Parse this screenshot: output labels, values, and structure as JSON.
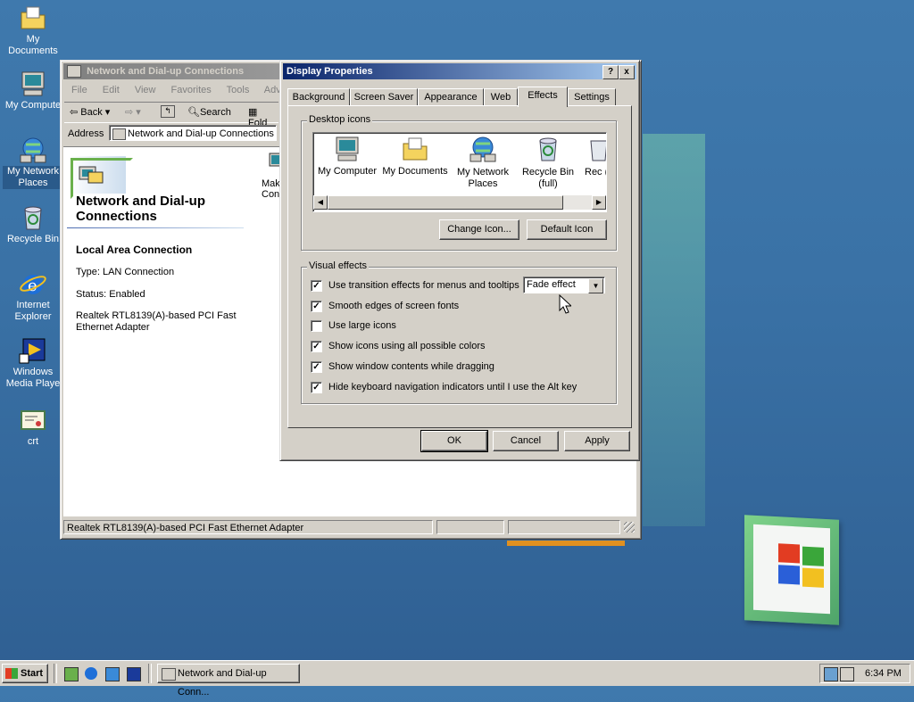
{
  "desktop": {
    "icons": [
      {
        "label": "My Documents",
        "icon": "folder-documents-icon"
      },
      {
        "label": "My Compute",
        "icon": "my-computer-icon"
      },
      {
        "label": "My Network Places",
        "icon": "network-places-icon"
      },
      {
        "label": "Recycle Bin",
        "icon": "recycle-bin-icon"
      },
      {
        "label": "Internet Explorer",
        "icon": "internet-explorer-icon"
      },
      {
        "label": "Windows Media Playe",
        "icon": "media-player-icon"
      },
      {
        "label": "crt",
        "icon": "certificate-icon"
      }
    ]
  },
  "explorer": {
    "title": "Network and Dial-up Connections",
    "menu": [
      "File",
      "Edit",
      "View",
      "Favorites",
      "Tools",
      "Adva"
    ],
    "toolbar": {
      "back": "Back",
      "search": "Search",
      "folders": "Fold"
    },
    "address_label": "Address",
    "address_value": "Network and Dial-up Connections",
    "heading": "Network and Dial-up Connections",
    "item_name": "Local Area Connection",
    "item_type": "Type: LAN Connection",
    "item_status": "Status: Enabled",
    "item_adapter": "Realtek RTL8139(A)-based PCI Fast Ethernet Adapter",
    "make_new": "Make Conne",
    "statusbar": "Realtek RTL8139(A)-based PCI Fast Ethernet Adapter"
  },
  "dialog": {
    "title": "Display Properties",
    "help_btn": "?",
    "close_btn": "x",
    "tabs": [
      "Background",
      "Screen Saver",
      "Appearance",
      "Web",
      "Effects",
      "Settings"
    ],
    "active_tab": "Effects",
    "desktop_icons_group": "Desktop icons",
    "icon_list": [
      {
        "label": "My Computer"
      },
      {
        "label": "My Documents"
      },
      {
        "label": "My Network Places"
      },
      {
        "label": "Recycle Bin (full)"
      },
      {
        "label": "Rec (e"
      }
    ],
    "change_icon": "Change Icon...",
    "default_icon": "Default Icon",
    "visual_effects_group": "Visual effects",
    "effects": [
      {
        "label": "Use transition effects for menus and tooltips",
        "checked": true
      },
      {
        "label": "Smooth edges of screen fonts",
        "checked": true
      },
      {
        "label": "Use large icons",
        "checked": false
      },
      {
        "label": "Show icons using all possible colors",
        "checked": true
      },
      {
        "label": "Show window contents while dragging",
        "checked": true
      },
      {
        "label": "Hide keyboard navigation indicators until I use the Alt key",
        "checked": true
      }
    ],
    "transition_select": "Fade effect",
    "ok": "OK",
    "cancel": "Cancel",
    "apply": "Apply"
  },
  "taskbar": {
    "start": "Start",
    "task_button": "Network and Dial-up Conn...",
    "clock": "6:34 PM"
  },
  "colors": {
    "titlebar_active": "#0a246a",
    "desktop": "#3a72a6",
    "face": "#d4d0c8"
  }
}
